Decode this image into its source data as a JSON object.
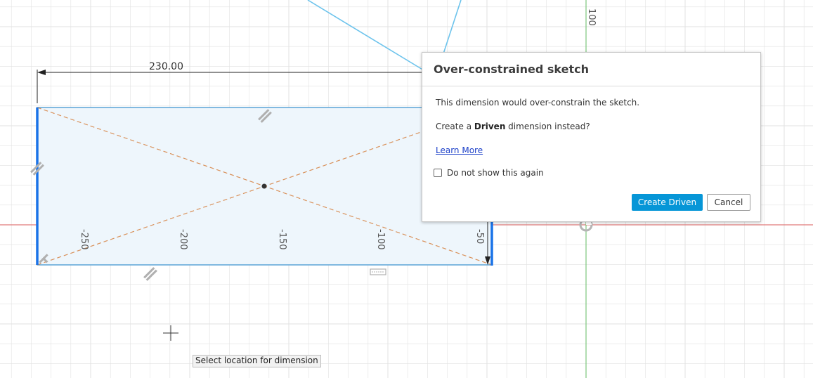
{
  "canvas": {
    "x_axis_ticks": [
      "-250",
      "-200",
      "-150",
      "-100",
      "-50"
    ],
    "y_axis_tick": "100",
    "dimension_value": "230.00",
    "colors": {
      "grid": "#e2e2e2",
      "x_axis": "#e07a7a",
      "y_axis": "#7bc67b",
      "sketch_fill": "#eef6fc",
      "sketch_edge": "#5aa3d6",
      "selected_edge": "#1a73e8",
      "construction": "#d9915a",
      "projected_line": "#6cc3ec"
    }
  },
  "dialog": {
    "title": "Over-constrained sketch",
    "message": "This dimension would over-constrain the sketch.",
    "question_prefix": "Create a ",
    "question_bold": "Driven",
    "question_suffix": " dimension instead?",
    "learn_more": "Learn More",
    "checkbox_label": "Do not show this again",
    "checkbox_checked": false,
    "primary_button": "Create Driven",
    "secondary_button": "Cancel",
    "accent_color": "#0696d7"
  },
  "tooltip": {
    "text": "Select location for dimension"
  }
}
